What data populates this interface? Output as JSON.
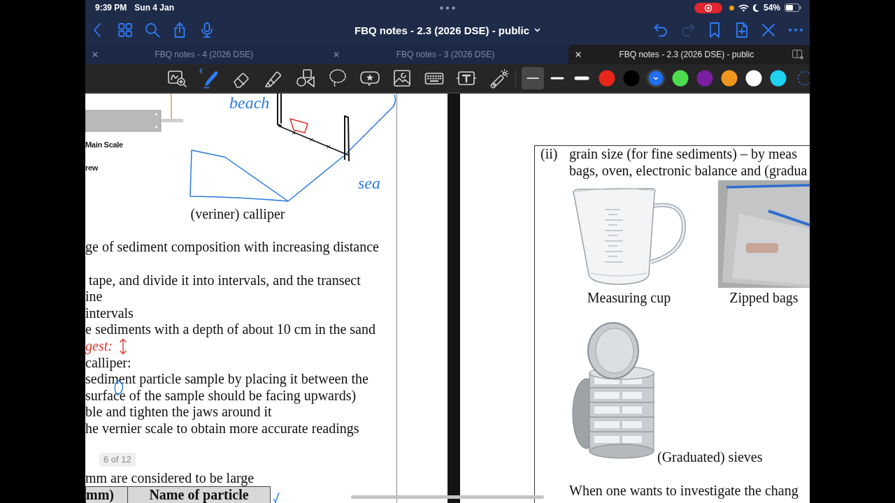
{
  "status_bar": {
    "time": "9:39 PM",
    "date": "Sun 4 Jan",
    "battery": "54%"
  },
  "nav_bar": {
    "left_buttons": [
      {
        "kind": "back"
      },
      {
        "kind": "grid"
      },
      {
        "kind": "search"
      },
      {
        "kind": "share"
      },
      {
        "kind": "microphone"
      }
    ],
    "title": "FBQ notes - 2.3 (2026 DSE) - public",
    "right_buttons": [
      {
        "kind": "undo",
        "disabled": false
      },
      {
        "kind": "redo",
        "disabled": true
      },
      {
        "kind": "bookmark",
        "disabled": false
      },
      {
        "kind": "add_page",
        "disabled": false
      },
      {
        "kind": "close",
        "disabled": false
      },
      {
        "kind": "more",
        "disabled": false
      }
    ]
  },
  "tabs": [
    {
      "label": "FBQ notes - 4 (2026 DSE)",
      "selected": false
    },
    {
      "label": "FBQ notes - 3 (2026 DSE)",
      "selected": false
    },
    {
      "label": "FBQ notes - 2.3 (2026 DSE) - public",
      "selected": true
    }
  ],
  "toolbar": {
    "tools": [
      {
        "kind": "zoom_window",
        "selected": false
      },
      {
        "kind": "pen",
        "selected": true
      },
      {
        "kind": "eraser",
        "selected": false
      },
      {
        "kind": "highlighter",
        "selected": false
      },
      {
        "kind": "shapes",
        "selected": false
      },
      {
        "kind": "lasso",
        "selected": false
      },
      {
        "kind": "sticker",
        "selected": false
      },
      {
        "kind": "image",
        "selected": false
      },
      {
        "kind": "keyboard",
        "selected": false
      },
      {
        "kind": "text_box",
        "selected": false
      },
      {
        "kind": "laser_pointer",
        "selected": false
      }
    ],
    "stroke_widths": [
      {
        "kind": "fine",
        "selected": true
      },
      {
        "kind": "medium",
        "selected": false
      },
      {
        "kind": "thick",
        "selected": false
      }
    ],
    "colors": [
      {
        "color": "#e8261c",
        "selected": false
      },
      {
        "color": "#000000",
        "selected": false
      },
      {
        "color": "#1e6ff2",
        "selected": true
      },
      {
        "color": "#4cdc4c",
        "selected": false
      },
      {
        "color": "#7a1fa0",
        "selected": false
      },
      {
        "color": "#f0961e",
        "selected": false
      },
      {
        "color": "#ffffff",
        "selected": false
      },
      {
        "color": "#1ed2f0",
        "selected": false
      }
    ]
  },
  "left_page": {
    "figure_labels": [
      "Main Scale",
      "rew"
    ],
    "sketch_labels": [
      "beach",
      "sea"
    ],
    "caption": "(veriner) calliper",
    "paragraphs": [
      [
        "ge of sediment composition with increasing distance"
      ],
      [
        "tape, and divide it into intervals, and the transect",
        "ine",
        "intervals",
        "e sediments with a depth of about 10 cm in the sand"
      ],
      [
        "calliper:",
        "sediment particle sample by placing it between the",
        "surface of the sample should be facing upwards)",
        "ble and tighten the jaws around it",
        "he vernier scale to obtain more accurate readings"
      ],
      [
        "mm are considered to be large"
      ]
    ],
    "margin_note": "gest:",
    "table_header": [
      "mm)",
      "Name of particle"
    ]
  },
  "right_page": {
    "label": "(ii)",
    "lines": [
      "grain size (for fine sediments) – by meas",
      "bags, oven, electronic balance and (gradua"
    ],
    "figures": [
      {
        "kind": "measuring_cup",
        "caption": "Measuring cup"
      },
      {
        "kind": "zipped_bags",
        "caption": "Zipped bags"
      },
      {
        "kind": "sieves",
        "caption": "(Graduated) sieves"
      }
    ],
    "paragraph": "When one wants to investigate the chang"
  },
  "page_indicator": "6 of 12"
}
